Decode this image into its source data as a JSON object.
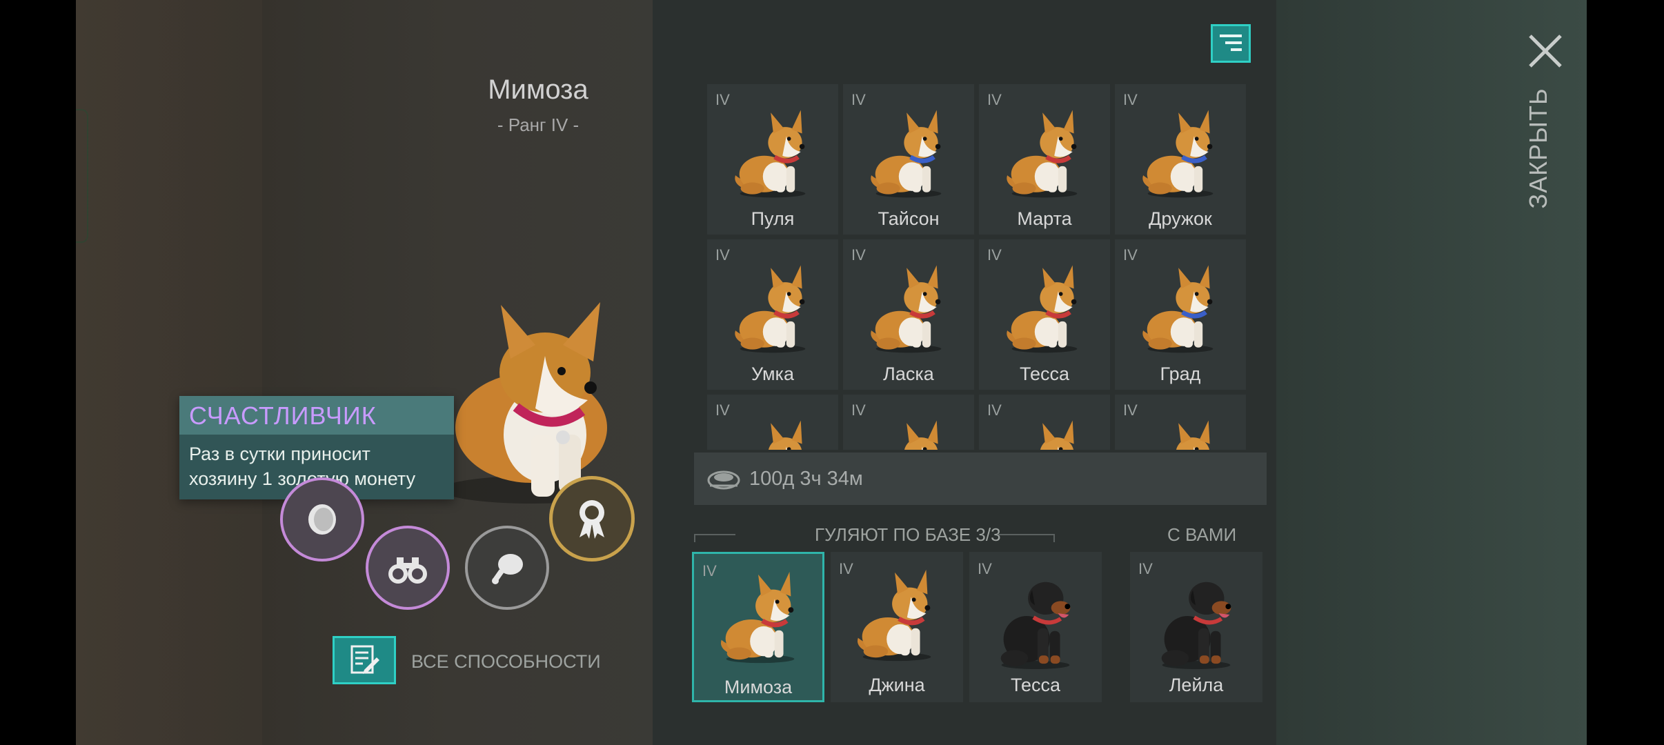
{
  "pet": {
    "name": "Мимоза",
    "rank": "- Ранг IV -"
  },
  "tooltip": {
    "title": "СЧАСТЛИВЧИК",
    "line1": "Раз в сутки приносит",
    "line2": "хозяину 1 золотую монету"
  },
  "abilities": [
    {
      "icon": "coin-icon",
      "color": "#c48ad8"
    },
    {
      "icon": "binoculars-icon",
      "color": "#c48ad8"
    },
    {
      "icon": "meat-icon",
      "color": "#9a9a9a"
    },
    {
      "icon": "medal-icon",
      "color": "#c9a24c"
    }
  ],
  "all_abilities_label": "ВСЕ СПОСОБНОСТИ",
  "grid": [
    {
      "tier": "IV",
      "name": "Пуля",
      "collar": "#c83a3a"
    },
    {
      "tier": "IV",
      "name": "Тайсон",
      "collar": "#3a5fc8"
    },
    {
      "tier": "IV",
      "name": "Марта",
      "collar": "#c83a3a"
    },
    {
      "tier": "IV",
      "name": "Дружок",
      "collar": "#3a5fc8"
    },
    {
      "tier": "IV",
      "name": "Умка",
      "collar": "#c83a3a"
    },
    {
      "tier": "IV",
      "name": "Ласка",
      "collar": "#c83a3a"
    },
    {
      "tier": "IV",
      "name": "Тесса",
      "collar": "#c83a3a"
    },
    {
      "tier": "IV",
      "name": "Град",
      "collar": "#3a5fc8"
    },
    {
      "tier": "IV",
      "name": "",
      "collar": "#c83a3a"
    },
    {
      "tier": "IV",
      "name": "",
      "collar": "#c83a3a"
    },
    {
      "tier": "IV",
      "name": "",
      "collar": "#3a5fc8"
    },
    {
      "tier": "IV",
      "name": "",
      "collar": "#c83a3a"
    }
  ],
  "timer": {
    "icon": "food-bowl-icon",
    "text": "100д 3ч 34м"
  },
  "walking": {
    "label": "ГУЛЯЮТ ПО БАЗЕ 3/3"
  },
  "with_you": {
    "label": "С ВАМИ"
  },
  "bottom": [
    {
      "tier": "IV",
      "name": "Мимоза",
      "breed": "corgi",
      "selected": true
    },
    {
      "tier": "IV",
      "name": "Джина",
      "breed": "corgi",
      "selected": false
    },
    {
      "tier": "IV",
      "name": "Тесса",
      "breed": "rottweiler",
      "selected": false
    },
    {
      "tier": "IV",
      "name": "Лейла",
      "breed": "rottweiler",
      "selected": false
    }
  ],
  "close_label": "ЗАКРЫТЬ",
  "colors": {
    "accent": "#2fd0c5",
    "tooltip_title": "#c89bff"
  }
}
